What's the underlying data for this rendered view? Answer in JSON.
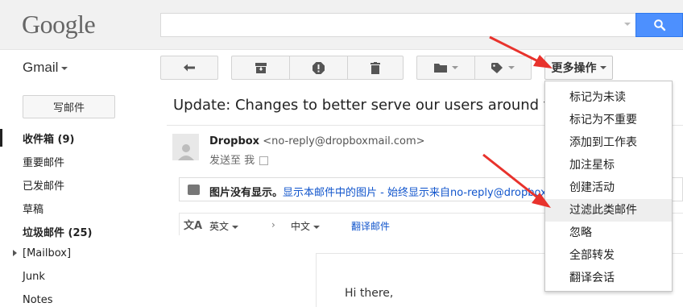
{
  "header": {
    "logo": "Google",
    "search": {
      "value": "",
      "placeholder": ""
    }
  },
  "toolbar": {
    "app_label": "Gmail",
    "more_label": "更多操作"
  },
  "sidebar": {
    "compose_label": "写邮件",
    "items": [
      {
        "label": "收件箱 (9)",
        "bold": true
      },
      {
        "label": "重要邮件",
        "bold": false
      },
      {
        "label": "已发邮件",
        "bold": false
      },
      {
        "label": "草稿",
        "bold": false
      },
      {
        "label": "垃圾邮件 (25)",
        "bold": true
      },
      {
        "label": "[Mailbox]",
        "bold": false
      },
      {
        "label": "Junk",
        "bold": false
      },
      {
        "label": "Notes",
        "bold": false
      }
    ]
  },
  "message": {
    "subject": "Update: Changes to better serve our users around the world",
    "sender_name": "Dropbox",
    "sender_email": "<no-reply@dropboxmail.com>",
    "sent_to": "发送至 我",
    "images_notice": "图片没有显示。",
    "show_images_link": "显示本邮件中的图片",
    "separator": " - ",
    "always_show_link": "始终显示来自no-reply@dropboxmail.com的图片",
    "translate": {
      "from_lang": "英文",
      "arrow": "›",
      "to_lang": "中文",
      "translate_link": "翻译邮件"
    },
    "greeting": "Hi there,"
  },
  "menu": {
    "items": [
      "标记为未读",
      "标记为不重要",
      "添加到工作表",
      "加注星标",
      "创建活动",
      "过滤此类邮件",
      "忽略",
      "全部转发",
      "翻译会话"
    ],
    "highlighted_index": 5
  },
  "colors": {
    "accent_blue": "#4d90fe",
    "link_blue": "#1155cc",
    "annotation_red": "#e8322c"
  }
}
